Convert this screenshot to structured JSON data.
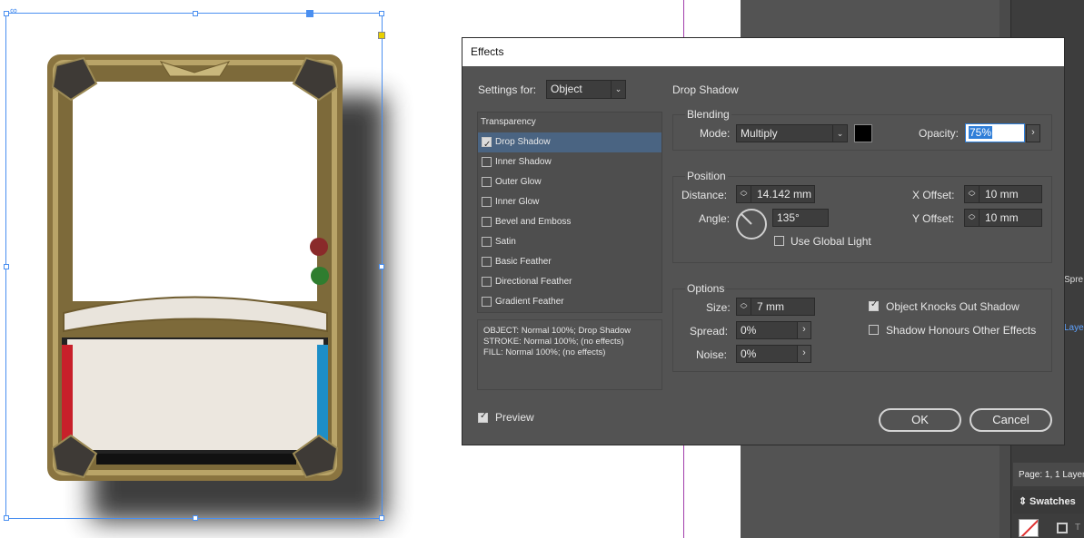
{
  "dialog": {
    "title": "Effects",
    "settings_for_label": "Settings for:",
    "settings_for_value": "Object",
    "transparency_label": "Transparency",
    "effects": [
      {
        "label": "Drop Shadow",
        "checked": true,
        "selected": true
      },
      {
        "label": "Inner Shadow",
        "checked": false,
        "selected": false
      },
      {
        "label": "Outer Glow",
        "checked": false,
        "selected": false
      },
      {
        "label": "Inner Glow",
        "checked": false,
        "selected": false
      },
      {
        "label": "Bevel and Emboss",
        "checked": false,
        "selected": false
      },
      {
        "label": "Satin",
        "checked": false,
        "selected": false
      },
      {
        "label": "Basic Feather",
        "checked": false,
        "selected": false
      },
      {
        "label": "Directional Feather",
        "checked": false,
        "selected": false
      },
      {
        "label": "Gradient Feather",
        "checked": false,
        "selected": false
      }
    ],
    "summary": [
      "OBJECT: Normal 100%; Drop Shadow",
      "STROKE: Normal 100%; (no effects)",
      "FILL: Normal 100%; (no effects)"
    ],
    "preview_label": "Preview",
    "preview_checked": true,
    "section_title": "Drop Shadow",
    "blending": {
      "title": "Blending",
      "mode_label": "Mode:",
      "mode_value": "Multiply",
      "color": "#000000",
      "opacity_label": "Opacity:",
      "opacity_value": "75%"
    },
    "position": {
      "title": "Position",
      "distance_label": "Distance:",
      "distance_value": "14.142 mm",
      "angle_label": "Angle:",
      "angle_value": "135°",
      "global_light_label": "Use Global Light",
      "global_light_checked": false,
      "x_offset_label": "X Offset:",
      "x_offset_value": "10 mm",
      "y_offset_label": "Y Offset:",
      "y_offset_value": "10 mm"
    },
    "options": {
      "title": "Options",
      "size_label": "Size:",
      "size_value": "7 mm",
      "spread_label": "Spread:",
      "spread_value": "0%",
      "noise_label": "Noise:",
      "noise_value": "0%",
      "knocks_out_label": "Object Knocks Out Shadow",
      "knocks_out_checked": true,
      "honours_label": "Shadow Honours Other Effects",
      "honours_checked": false
    },
    "ok_label": "OK",
    "cancel_label": "Cancel"
  },
  "right_panel": {
    "spreads_label": "Spre",
    "layers_label": "Laye",
    "page_info": "Page: 1, 1 Layer",
    "swatches_label": "Swatches",
    "panel_marker": "T"
  },
  "colors": {
    "selection": "#4a8ff0",
    "accent": "#4a6482",
    "margin_guide": "#a23dab"
  }
}
